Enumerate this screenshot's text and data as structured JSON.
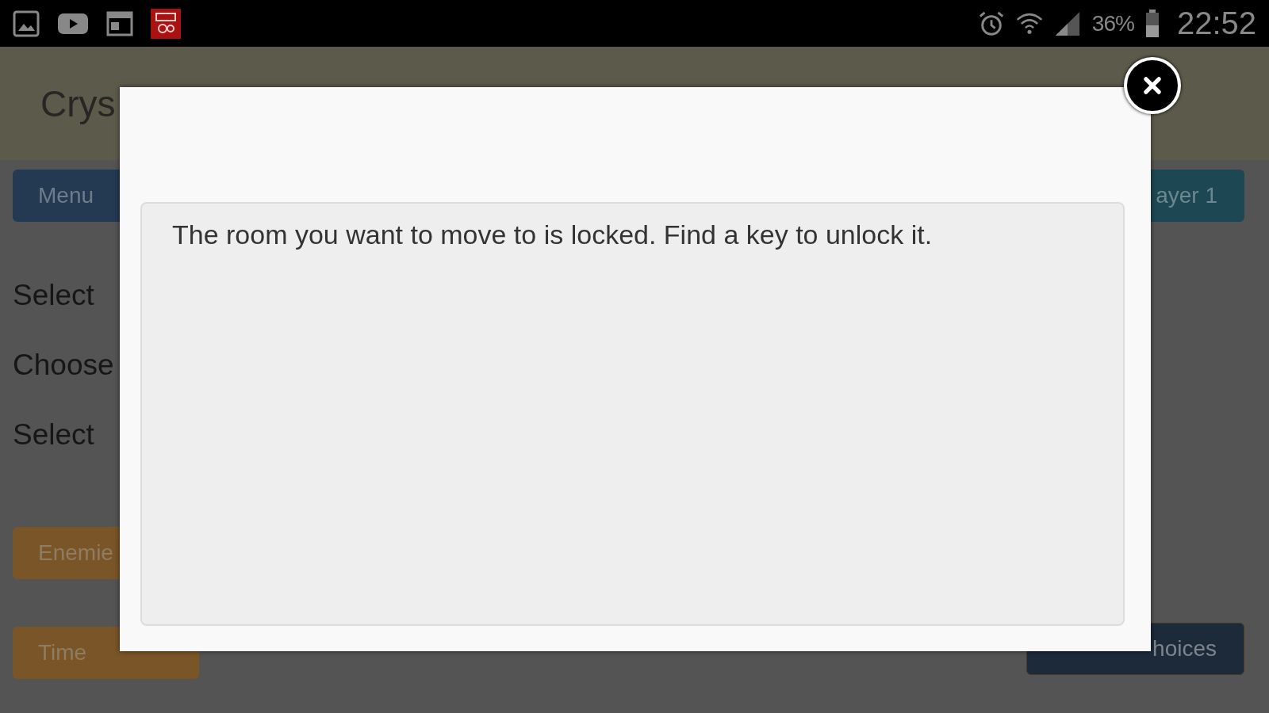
{
  "status_bar": {
    "battery": "36%",
    "time": "22:52"
  },
  "header": {
    "title": "Crys"
  },
  "left_buttons_top": [
    {
      "label": "Menu",
      "kind": "primary"
    }
  ],
  "left_texts": [
    "Select",
    "Choose",
    "Select"
  ],
  "left_buttons_bottom": [
    {
      "label": "Enemie",
      "kind": "warning"
    },
    {
      "label": "Time",
      "kind": "warning"
    }
  ],
  "right_buttons": [
    {
      "label": "ayer 1",
      "kind": "info"
    },
    {
      "label": "hoices",
      "kind": "dark"
    }
  ],
  "dialog": {
    "message": "The room you want to move to is locked. Find a key to unlock it."
  }
}
